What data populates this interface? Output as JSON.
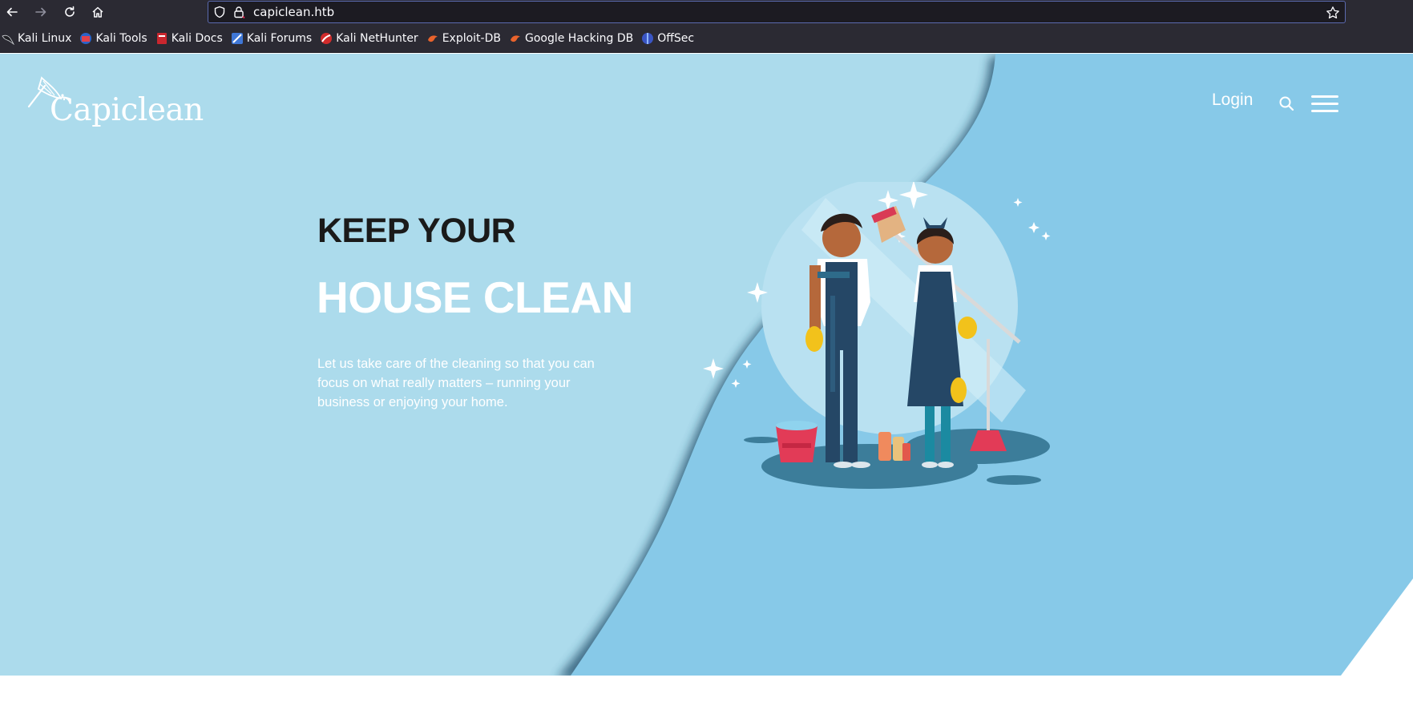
{
  "browser": {
    "url": "capiclean.htb",
    "nav": {
      "back_icon": "arrow-left-icon",
      "forward_icon": "arrow-right-icon",
      "reload_icon": "reload-icon",
      "home_icon": "home-icon"
    },
    "bookmarks": [
      {
        "label": "Kali Linux",
        "icon": "kali-dragon-icon"
      },
      {
        "label": "Kali Tools",
        "icon": "kali-tools-icon"
      },
      {
        "label": "Kali Docs",
        "icon": "kali-docs-icon"
      },
      {
        "label": "Kali Forums",
        "icon": "kali-forums-icon"
      },
      {
        "label": "Kali NetHunter",
        "icon": "kali-nethunter-icon"
      },
      {
        "label": "Exploit-DB",
        "icon": "exploit-db-icon"
      },
      {
        "label": "Google Hacking DB",
        "icon": "ghdb-icon"
      },
      {
        "label": "OffSec",
        "icon": "offsec-icon"
      }
    ]
  },
  "site": {
    "logo_text": "Capiclean",
    "nav": {
      "login": "Login",
      "search_icon": "search-icon",
      "menu_icon": "hamburger-menu-icon"
    },
    "hero": {
      "headline_1": "KEEP YOUR",
      "headline_2": "HOUSE CLEAN",
      "subtext": "Let us take care of the cleaning so that you can focus on what really matters – running your business or enjoying your home."
    }
  },
  "colors": {
    "hero_light": "#acdbec",
    "hero_dark": "#87c9e8",
    "shadow": "#1e4a66",
    "chrome_bg": "#2b2a33",
    "url_bg": "#1c1b22"
  }
}
